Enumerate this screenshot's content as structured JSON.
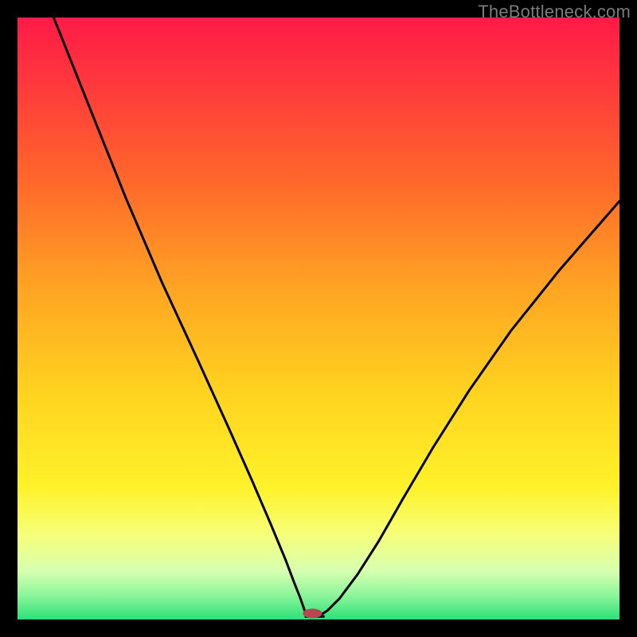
{
  "watermark": "TheBottleneck.com",
  "chart_data": {
    "type": "line",
    "title": "",
    "xlabel": "",
    "ylabel": "",
    "xlim": [
      0,
      100
    ],
    "ylim": [
      0,
      100
    ],
    "notes": "V-shaped curve on a red→green vertical gradient, with a small rounded marker at the valley. Axes are unlabeled (no ticks). Values are read geometrically as percentages of the inner plot area (22px inset, 756×756).",
    "gradient_stops": [
      {
        "offset": 0.0,
        "color": "#ff1a47"
      },
      {
        "offset": 0.12,
        "color": "#ff3b3b"
      },
      {
        "offset": 0.28,
        "color": "#ff6a2a"
      },
      {
        "offset": 0.45,
        "color": "#ffa423"
      },
      {
        "offset": 0.62,
        "color": "#ffd21f"
      },
      {
        "offset": 0.78,
        "color": "#fff22a"
      },
      {
        "offset": 0.86,
        "color": "#f6ff7a"
      },
      {
        "offset": 0.92,
        "color": "#d6ffb0"
      },
      {
        "offset": 0.96,
        "color": "#8cf59a"
      },
      {
        "offset": 1.0,
        "color": "#2de07a"
      }
    ],
    "series": [
      {
        "name": "curve",
        "x": [
          6.0,
          12.0,
          18.0,
          24.0,
          30.0,
          35.0,
          39.0,
          42.0,
          44.5,
          46.0,
          47.0,
          47.7,
          48.1,
          50.0,
          51.5,
          53.5,
          56.5,
          60.0,
          64.0,
          69.0,
          75.0,
          82.0,
          90.0,
          100.0
        ],
        "y": [
          100.0,
          85.0,
          70.0,
          56.0,
          43.0,
          32.0,
          23.0,
          16.0,
          10.0,
          6.0,
          3.5,
          1.5,
          0.5,
          0.5,
          1.5,
          3.5,
          7.5,
          13.0,
          20.0,
          28.5,
          38.0,
          48.0,
          58.0,
          69.5
        ]
      }
    ],
    "marker": {
      "x": 49.0,
      "y": 1.0,
      "rx": 1.6,
      "ry": 0.8,
      "color": "#b6494f"
    },
    "floor_y": 0.5
  }
}
